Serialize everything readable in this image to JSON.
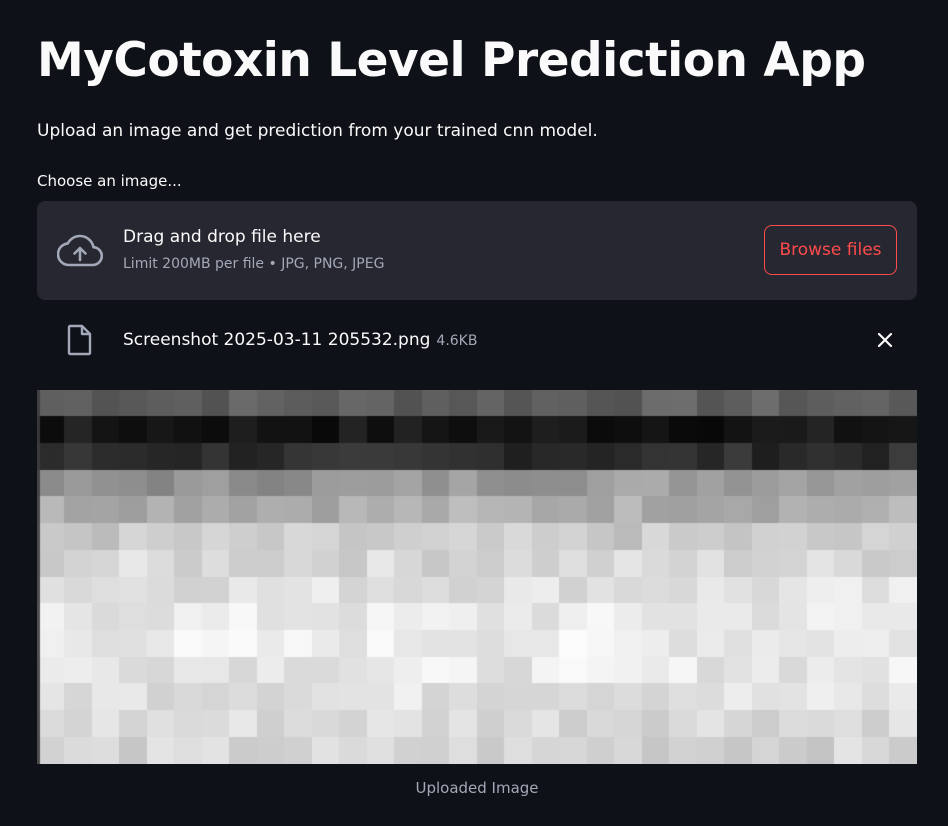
{
  "app": {
    "title": "MyCotoxin Level Prediction App",
    "subtitle": "Upload an image and get prediction from your trained cnn model."
  },
  "uploader": {
    "label": "Choose an image...",
    "drop_text": "Drag and drop file here",
    "limit_text": "Limit 200MB per file • JPG, PNG, JPEG",
    "browse_label": "Browse files",
    "cloud_icon": "cloud-upload-icon",
    "accent_color": "#ff4b4b"
  },
  "uploaded_file": {
    "name": "Screenshot 2025-03-11 205532.png",
    "size": "4.6KB",
    "file_icon": "file-icon",
    "close_icon": "close-icon"
  },
  "image": {
    "caption": "Uploaded Image"
  },
  "theme": {
    "background": "#0e1117",
    "surface": "#262730",
    "text": "#fafafa",
    "muted": "#a3a8b8"
  }
}
